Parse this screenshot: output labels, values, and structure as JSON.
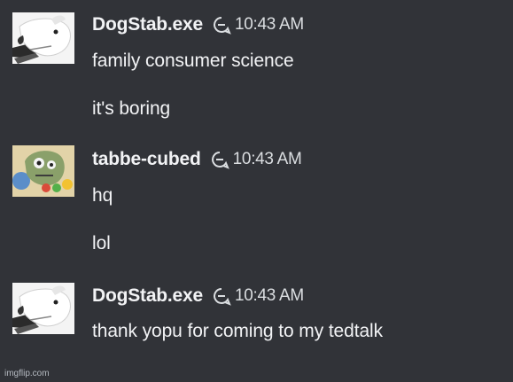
{
  "messages": [
    {
      "username": "DogStab.exe",
      "time": "10:43 AM",
      "avatar_icon": "white-dog-avatar",
      "lines": [
        "family consumer science",
        "it's boring"
      ]
    },
    {
      "username": "tabbe-cubed",
      "time": "10:43 AM",
      "avatar_icon": "cartoon-zombie-avatar",
      "lines": [
        "hq",
        "lol"
      ]
    },
    {
      "username": "DogStab.exe",
      "time": "10:43 AM",
      "avatar_icon": "white-dog-avatar",
      "lines": [
        "thank yopu for coming to my tedtalk"
      ]
    }
  ],
  "watermark": "imgflip.com",
  "colors": {
    "background": "#313338",
    "username": "#f2f3f5",
    "text": "#dbdee1"
  }
}
